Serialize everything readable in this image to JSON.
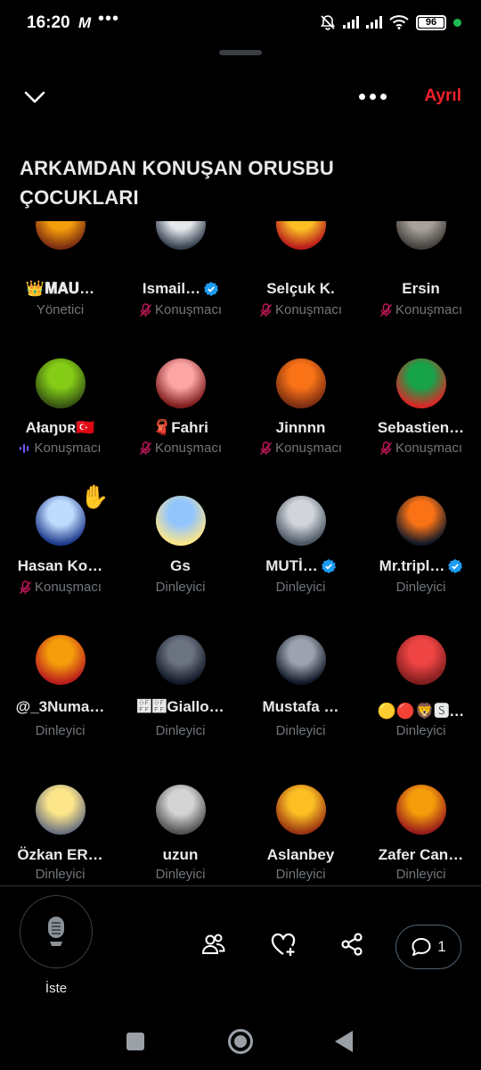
{
  "status": {
    "time": "16:20",
    "app_glyph": "M",
    "dots": "•••",
    "battery": "96"
  },
  "header": {
    "leave_label": "Ayrıl"
  },
  "space_title": "ARKAMDAN KONUŞAN ORUSBU ÇOCUKLARI",
  "colors": {
    "leave": "#f4212e",
    "muted": "#71767b",
    "verified": "#1d9bf0",
    "speaker_mic_off": "#c2185b",
    "speaking_wave": "#7856ff"
  },
  "participants": [
    {
      "name": "👑𝐌𝐀𝐔…",
      "role": "Yönetici"
    },
    {
      "name": "Ismail…",
      "role": "Konuşmacı"
    },
    {
      "name": "Selçuk K.",
      "role": "Konuşmacı"
    },
    {
      "name": "Ersin",
      "role": "Konuşmacı"
    },
    {
      "name": "Ałaŋʋʀ🇹🇷",
      "role": "Konuşmacı"
    },
    {
      "name": "🧣Fahri",
      "role": "Konuşmacı"
    },
    {
      "name": "Jinnnn",
      "role": "Konuşmacı"
    },
    {
      "name": "Sebastien…",
      "role": "Konuşmacı"
    },
    {
      "name": "Hasan Ko…",
      "role": "Konuşmacı"
    },
    {
      "name": "Gs",
      "role": "Dinleyici"
    },
    {
      "name": "MUTİ…",
      "role": "Dinleyici"
    },
    {
      "name": "Mr.tripl…",
      "role": "Dinleyici"
    },
    {
      "name": "@_3Numa…",
      "role": "Dinleyici"
    },
    {
      "name": "࿿࿿Giallo…",
      "role": "Dinleyici"
    },
    {
      "name": "Mustafa …",
      "role": "Dinleyici"
    },
    {
      "name": "🟡🔴🦁🆂…",
      "role": "Dinleyici"
    },
    {
      "name": "Özkan ER…",
      "role": "Dinleyici"
    },
    {
      "name": "uzun",
      "role": "Dinleyici"
    },
    {
      "name": "Aslanbey",
      "role": "Dinleyici"
    },
    {
      "name": "Zafer Can…",
      "role": "Dinleyici"
    }
  ],
  "bottom": {
    "request_label": "İste",
    "comment_count": "1"
  }
}
